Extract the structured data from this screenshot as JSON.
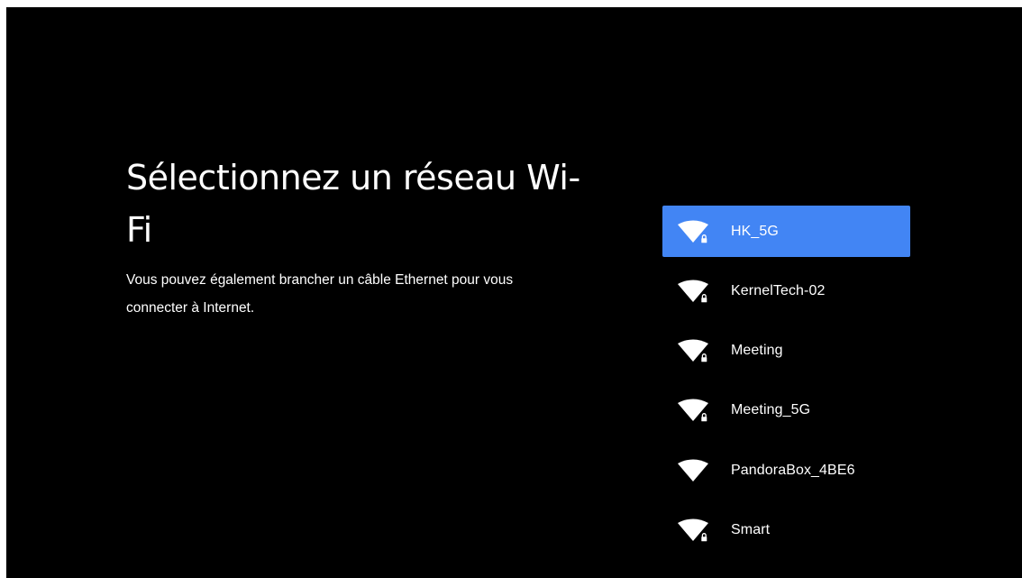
{
  "header": {
    "title": "Sélectionnez un réseau Wi-Fi",
    "subtitle": "Vous pouvez également brancher un câble Ethernet pour vous connecter à Internet."
  },
  "colors": {
    "background": "#000000",
    "selected": "#4285f4",
    "text": "#ffffff"
  },
  "networks": [
    {
      "name": "HK_5G",
      "icon": "wifi-lock-icon",
      "secured": true,
      "selected": true
    },
    {
      "name": "KernelTech-02",
      "icon": "wifi-lock-icon",
      "secured": true,
      "selected": false
    },
    {
      "name": "Meeting",
      "icon": "wifi-lock-icon",
      "secured": true,
      "selected": false
    },
    {
      "name": "Meeting_5G",
      "icon": "wifi-lock-icon",
      "secured": true,
      "selected": false
    },
    {
      "name": "PandoraBox_4BE6",
      "icon": "wifi-icon",
      "secured": false,
      "selected": false
    },
    {
      "name": "Smart",
      "icon": "wifi-lock-icon",
      "secured": true,
      "selected": false
    }
  ]
}
